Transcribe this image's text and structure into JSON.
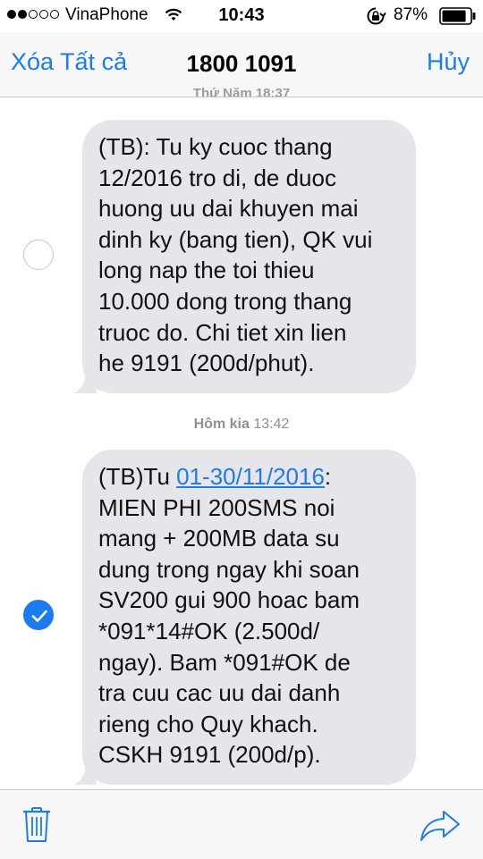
{
  "status_bar": {
    "carrier": "VinaPhone",
    "time": "10:43",
    "battery_percent": "87%",
    "battery_level": 0.87,
    "signal_bars_filled": 2,
    "signal_bars_total": 5
  },
  "nav": {
    "left_button": "Xóa Tất cả",
    "title": "1800 1091",
    "right_button": "Hủy",
    "scrolled_timestamp": "Thứ Năm 18:37"
  },
  "messages": [
    {
      "selected": false,
      "lines": [
        "(TB): Tu ky cuoc thang",
        "12/2016 tro di, de duoc",
        "huong uu dai khuyen mai",
        "dinh ky (bang tien), QK vui",
        "long nap the toi thieu",
        "10.000 dong trong thang",
        "truoc do. Chi tiet xin lien",
        "he 9191 (200d/phut)."
      ]
    },
    {
      "selected": true,
      "first_line_prefix": "(TB)Tu ",
      "first_line_link": "01-30/11/2016",
      "first_line_suffix": ":",
      "lines": [
        "MIEN PHI 200SMS noi",
        "mang + 200MB data su",
        "dung trong ngay khi soan",
        "SV200 gui 900 hoac bam",
        "*091*14#OK (2.500d/",
        "ngay). Bam *091#OK de",
        "tra cuu cac uu dai danh",
        "rieng cho Quy khach.",
        "CSKH 9191 (200d/p)."
      ]
    }
  ],
  "timestamp_2": {
    "day": "Hôm kia",
    "time": "13:42"
  },
  "toolbar": {
    "left_icon": "trash-icon",
    "right_icon": "share-icon"
  },
  "colors": {
    "accent": "#1a7cf0",
    "bubble": "#e5e5ea",
    "bar": "#f7f7f7"
  }
}
